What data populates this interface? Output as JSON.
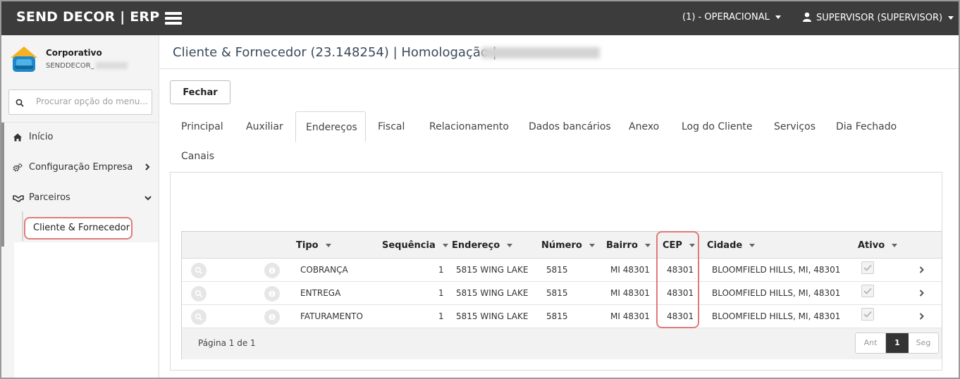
{
  "topbar": {
    "brand": "SEND DECOR | ERP",
    "operation": "(1) - OPERACIONAL",
    "user": "SUPERVISOR (SUPERVISOR)"
  },
  "sidebar": {
    "company_name": "Corporativo",
    "company_code": "SENDDECOR_",
    "search_placeholder": "Procurar opção do menu...",
    "items": [
      {
        "label": "Início",
        "icon": "home-icon"
      },
      {
        "label": "Configuração Empresa",
        "icon": "gears-icon"
      },
      {
        "label": "Parceiros",
        "icon": "handshake-icon"
      }
    ],
    "sub_item": "Cliente & Fornecedor"
  },
  "page": {
    "title": "Cliente & Fornecedor (23.148254) | Homologação |",
    "close_button": "Fechar"
  },
  "tabs": [
    {
      "label": "Principal"
    },
    {
      "label": "Auxiliar"
    },
    {
      "label": "Endereços",
      "active": true
    },
    {
      "label": "Fiscal"
    },
    {
      "label": "Relacionamento"
    },
    {
      "label": "Dados bancários"
    },
    {
      "label": "Anexo"
    },
    {
      "label": "Log do Cliente"
    },
    {
      "label": "Serviços"
    },
    {
      "label": "Dia Fechado"
    },
    {
      "label": "Canais"
    }
  ],
  "grid": {
    "headers": {
      "tipo": "Tipo",
      "sequencia": "Sequência",
      "endereco": "Endereço",
      "numero": "Número",
      "bairro": "Bairro",
      "cep": "CEP",
      "cidade": "Cidade",
      "ativo": "Ativo"
    },
    "rows": [
      {
        "tipo": "COBRANÇA",
        "sequencia": "1",
        "endereco": "5815 WING LAKE",
        "numero": "5815",
        "bairro": "MI 48301",
        "cep": "48301",
        "cidade": "BLOOMFIELD HILLS, MI, 48301",
        "ativo": true
      },
      {
        "tipo": "ENTREGA",
        "sequencia": "1",
        "endereco": "5815 WING LAKE",
        "numero": "5815",
        "bairro": "MI 48301",
        "cep": "48301",
        "cidade": "BLOOMFIELD HILLS, MI, 48301",
        "ativo": true
      },
      {
        "tipo": "FATURAMENTO",
        "sequencia": "1",
        "endereco": "5815 WING LAKE",
        "numero": "5815",
        "bairro": "MI 48301",
        "cep": "48301",
        "cidade": "BLOOMFIELD HILLS, MI, 48301",
        "ativo": true
      }
    ],
    "page_info": "Página 1 de 1",
    "pager": {
      "prev": "Ant",
      "current": "1",
      "next": "Seg"
    }
  },
  "colors": {
    "topbar": "#3c3c3c",
    "highlight": "#e07a7a",
    "title": "#3a4a5c"
  }
}
